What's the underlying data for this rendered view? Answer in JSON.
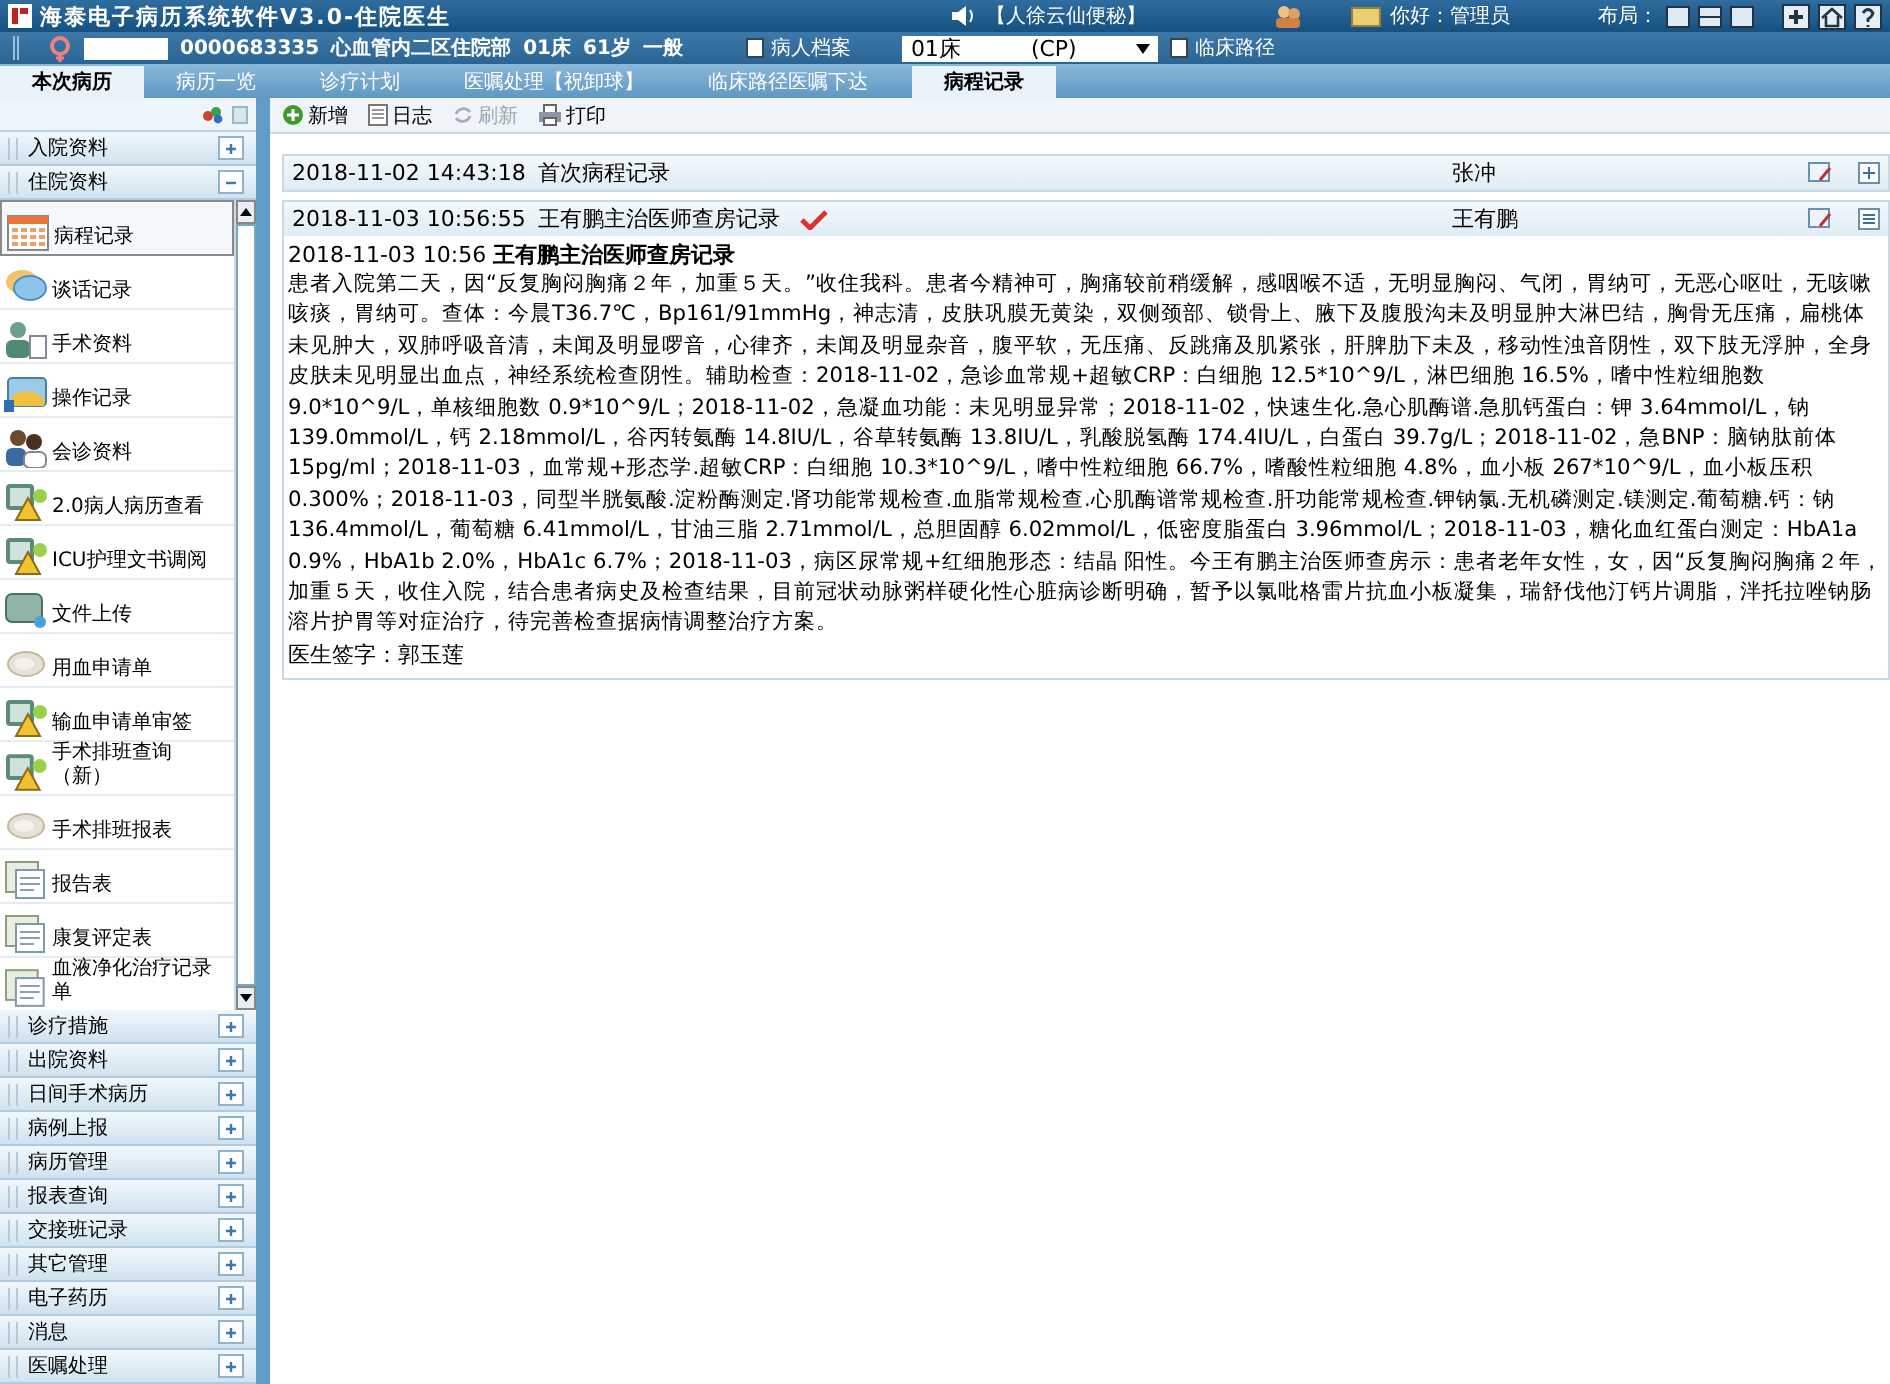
{
  "app_title": "海泰电子病历系统软件V3.0-住院医生",
  "header_right": {
    "tip": "【人徐云仙便秘】",
    "greeting": "你好：管理员",
    "layout_label": "布局："
  },
  "patient": {
    "id": "0000683335",
    "dept": "心血管内二区住院部",
    "bed": "01床",
    "age": "61岁",
    "level": "一般",
    "archive_button": "病人档案",
    "bed_select": "01床",
    "bed_code": "(CP)",
    "pathway_button": "临床路径"
  },
  "tabs": [
    {
      "label": "本次病历",
      "selected": true
    },
    {
      "label": "病历一览",
      "selected": false
    },
    {
      "label": "诊疗计划",
      "selected": false
    },
    {
      "label": "医嘱处理【祝卸球】",
      "selected": false
    },
    {
      "label": "临床路径医嘱下达",
      "selected": false
    },
    {
      "label": "病程记录",
      "selected": true
    }
  ],
  "sidebar": {
    "sections_before": [
      {
        "label": "入院资料",
        "expanded": false
      },
      {
        "label": "住院资料",
        "expanded": true
      }
    ],
    "items": [
      {
        "label": "病程记录",
        "kind": "calendar",
        "selected": true
      },
      {
        "label": "谈话记录",
        "kind": "chat",
        "selected": false
      },
      {
        "label": "手术资料",
        "kind": "person",
        "selected": false
      },
      {
        "label": "操作记录",
        "kind": "folder",
        "selected": false
      },
      {
        "label": "会诊资料",
        "kind": "people",
        "selected": false
      },
      {
        "label": "2.0病人病历查看",
        "kind": "kit",
        "selected": false
      },
      {
        "label": "ICU护理文书调阅",
        "kind": "kit",
        "selected": false
      },
      {
        "label": "文件上传",
        "kind": "screen",
        "selected": false
      },
      {
        "label": "用血申请单",
        "kind": "bubble",
        "selected": false
      },
      {
        "label": "输血申请单审签",
        "kind": "kit",
        "selected": false
      },
      {
        "label": "手术排班查询（新）",
        "kind": "kit",
        "selected": false
      },
      {
        "label": "手术排班报表",
        "kind": "bubble",
        "selected": false
      },
      {
        "label": "报告表",
        "kind": "form",
        "selected": false
      },
      {
        "label": "康复评定表",
        "kind": "form",
        "selected": false
      },
      {
        "label": "血液净化治疗记录单",
        "kind": "form",
        "selected": false
      }
    ],
    "sections_after": [
      {
        "label": "诊疗措施",
        "expanded": false
      },
      {
        "label": "出院资料",
        "expanded": false
      },
      {
        "label": "日间手术病历",
        "expanded": false
      },
      {
        "label": "病例上报",
        "expanded": false
      },
      {
        "label": "病历管理",
        "expanded": false
      },
      {
        "label": "报表查询",
        "expanded": false
      },
      {
        "label": "交接班记录",
        "expanded": false
      },
      {
        "label": "其它管理",
        "expanded": false
      },
      {
        "label": "电子药历",
        "expanded": false
      },
      {
        "label": "消息",
        "expanded": false
      },
      {
        "label": "医嘱处理",
        "expanded": false
      }
    ]
  },
  "toolbar": [
    {
      "label": "新增",
      "kind": "add",
      "disabled": false
    },
    {
      "label": "日志",
      "kind": "log",
      "disabled": false
    },
    {
      "label": "刷新",
      "kind": "refresh",
      "disabled": true
    },
    {
      "label": "打印",
      "kind": "print",
      "disabled": false
    }
  ],
  "records": [
    {
      "time": "2018-11-02 14:43:18",
      "title": "首次病程记录",
      "doctor": "张冲",
      "checked": false,
      "expanded": false
    },
    {
      "time": "2018-11-03 10:56:55",
      "title": "王有鹏主治医师查房记录",
      "doctor": "王有鹏",
      "checked": true,
      "expanded": true,
      "detail": {
        "heading_time": "2018-11-03 10:56",
        "heading_title": "王有鹏主治医师查房记录",
        "body": "患者入院第二天，因“反复胸闷胸痛２年，加重５天。”收住我科。患者今精神可，胸痛较前稍缓解，感咽喉不适，无明显胸闷、气闭，胃纳可，无恶心呕吐，无咳嗽咳痰，胃纳可。查体：今晨T36.7℃，Bp161/91mmHg，神志清，皮肤巩膜无黄染，双侧颈部、锁骨上、腋下及腹股沟未及明显肿大淋巴结，胸骨无压痛，扁桃体未见肿大，双肺呼吸音清，未闻及明显啰音，心律齐，未闻及明显杂音，腹平软，无压痛、反跳痛及肌紧张，肝脾肋下未及，移动性浊音阴性，双下肢无浮肿，全身皮肤未见明显出血点，神经系统检查阴性。辅助检查：2018-11-02，急诊血常规+超敏CRP：白细胞 12.5*10^9/L，淋巴细胞 16.5%，嗜中性粒细胞数 9.0*10^9/L，单核细胞数 0.9*10^9/L；2018-11-02，急凝血功能：未见明显异常；2018-11-02，快速生化.急心肌酶谱.急肌钙蛋白：钾 3.64mmol/L，钠 139.0mmol/L，钙 2.18mmol/L，谷丙转氨酶 14.8IU/L，谷草转氨酶 13.8IU/L，乳酸脱氢酶 174.4IU/L，白蛋白 39.7g/L；2018-11-02，急BNP：脑钠肽前体 15pg/ml；2018-11-03，血常规+形态学.超敏CRP：白细胞 10.3*10^9/L，嗜中性粒细胞 66.7%，嗜酸性粒细胞 4.8%，血小板 267*10^9/L，血小板压积 0.300%；2018-11-03，同型半胱氨酸.淀粉酶测定.肾功能常规检查.血脂常规检查.心肌酶谱常规检查.肝功能常规检查.钾钠氯.无机磷测定.镁测定.葡萄糖.钙：钠 136.4mmol/L，葡萄糖 6.41mmol/L，甘油三脂 2.71mmol/L，总胆固醇 6.02mmol/L，低密度脂蛋白 3.96mmol/L；2018-11-03，糖化血红蛋白测定：HbA1a 0.9%，HbA1b 2.0%，HbA1c 6.7%；2018-11-03，病区尿常规+红细胞形态：结晶 阳性。今王有鹏主治医师查房示：患者老年女性，女，因“反复胸闷胸痛２年，加重５天，收住入院，结合患者病史及检查结果，目前冠状动脉粥样硬化性心脏病诊断明确，暂予以氯吡格雷片抗血小板凝集，瑞舒伐他汀钙片调脂，泮托拉唑钠肠溶片护胃等对症治疗，待完善检查据病情调整治疗方案。",
        "signature": "医生签字：郭玉莲"
      }
    }
  ]
}
